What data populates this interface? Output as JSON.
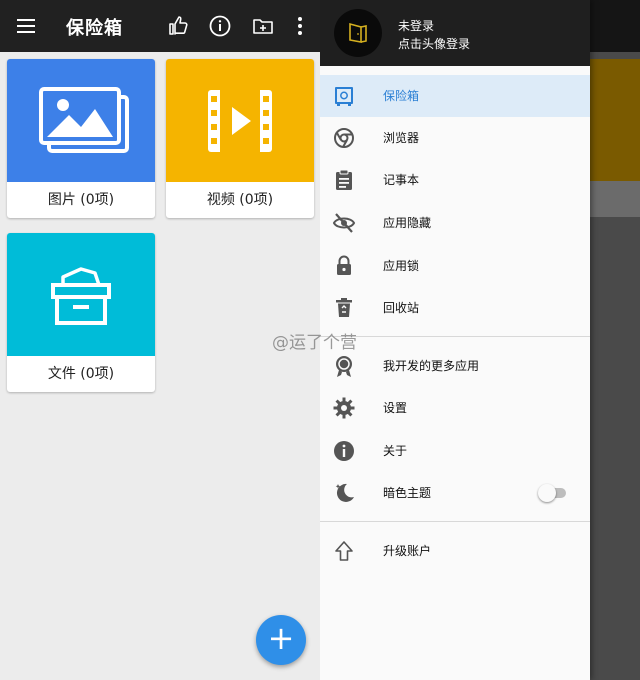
{
  "app": {
    "title": "保险箱",
    "icons": [
      "menu-icon",
      "thumb-up-icon",
      "info-icon",
      "add-folder-icon",
      "more-vert-icon"
    ]
  },
  "categories": [
    {
      "label": "图片 (0项)",
      "color": "#3d80e8",
      "icon": "image-icon"
    },
    {
      "label": "视频 (0项)",
      "color": "#f5b400",
      "icon": "video-icon"
    },
    {
      "label": "文件 (0项)",
      "color": "#00bcd8",
      "icon": "file-box-icon"
    }
  ],
  "fab": {
    "label": "+",
    "color": "#2f8fe8"
  },
  "watermark": "@运了个营",
  "drawer": {
    "header": {
      "line1": "未登录",
      "line2": "点击头像登录"
    },
    "items": [
      {
        "label": "保险箱",
        "icon": "safe-icon",
        "active": true
      },
      {
        "label": "浏览器",
        "icon": "browser-icon"
      },
      {
        "label": "记事本",
        "icon": "clipboard-icon"
      },
      {
        "label": "应用隐藏",
        "icon": "eye-off-icon"
      },
      {
        "label": "应用锁",
        "icon": "lock-icon"
      },
      {
        "label": "回收站",
        "icon": "recycle-bin-icon"
      },
      {
        "label": "我开发的更多应用",
        "icon": "badge-icon"
      },
      {
        "label": "设置",
        "icon": "gear-icon"
      },
      {
        "label": "关于",
        "icon": "info-icon"
      },
      {
        "label": "暗色主题",
        "icon": "moon-icon",
        "toggle": false
      },
      {
        "label": "升级账户",
        "icon": "upgrade-arrow-icon"
      }
    ]
  },
  "colors": {
    "accent": "#2a7fd4",
    "appbar": "#212121",
    "active_bg": "#ddebf8"
  }
}
